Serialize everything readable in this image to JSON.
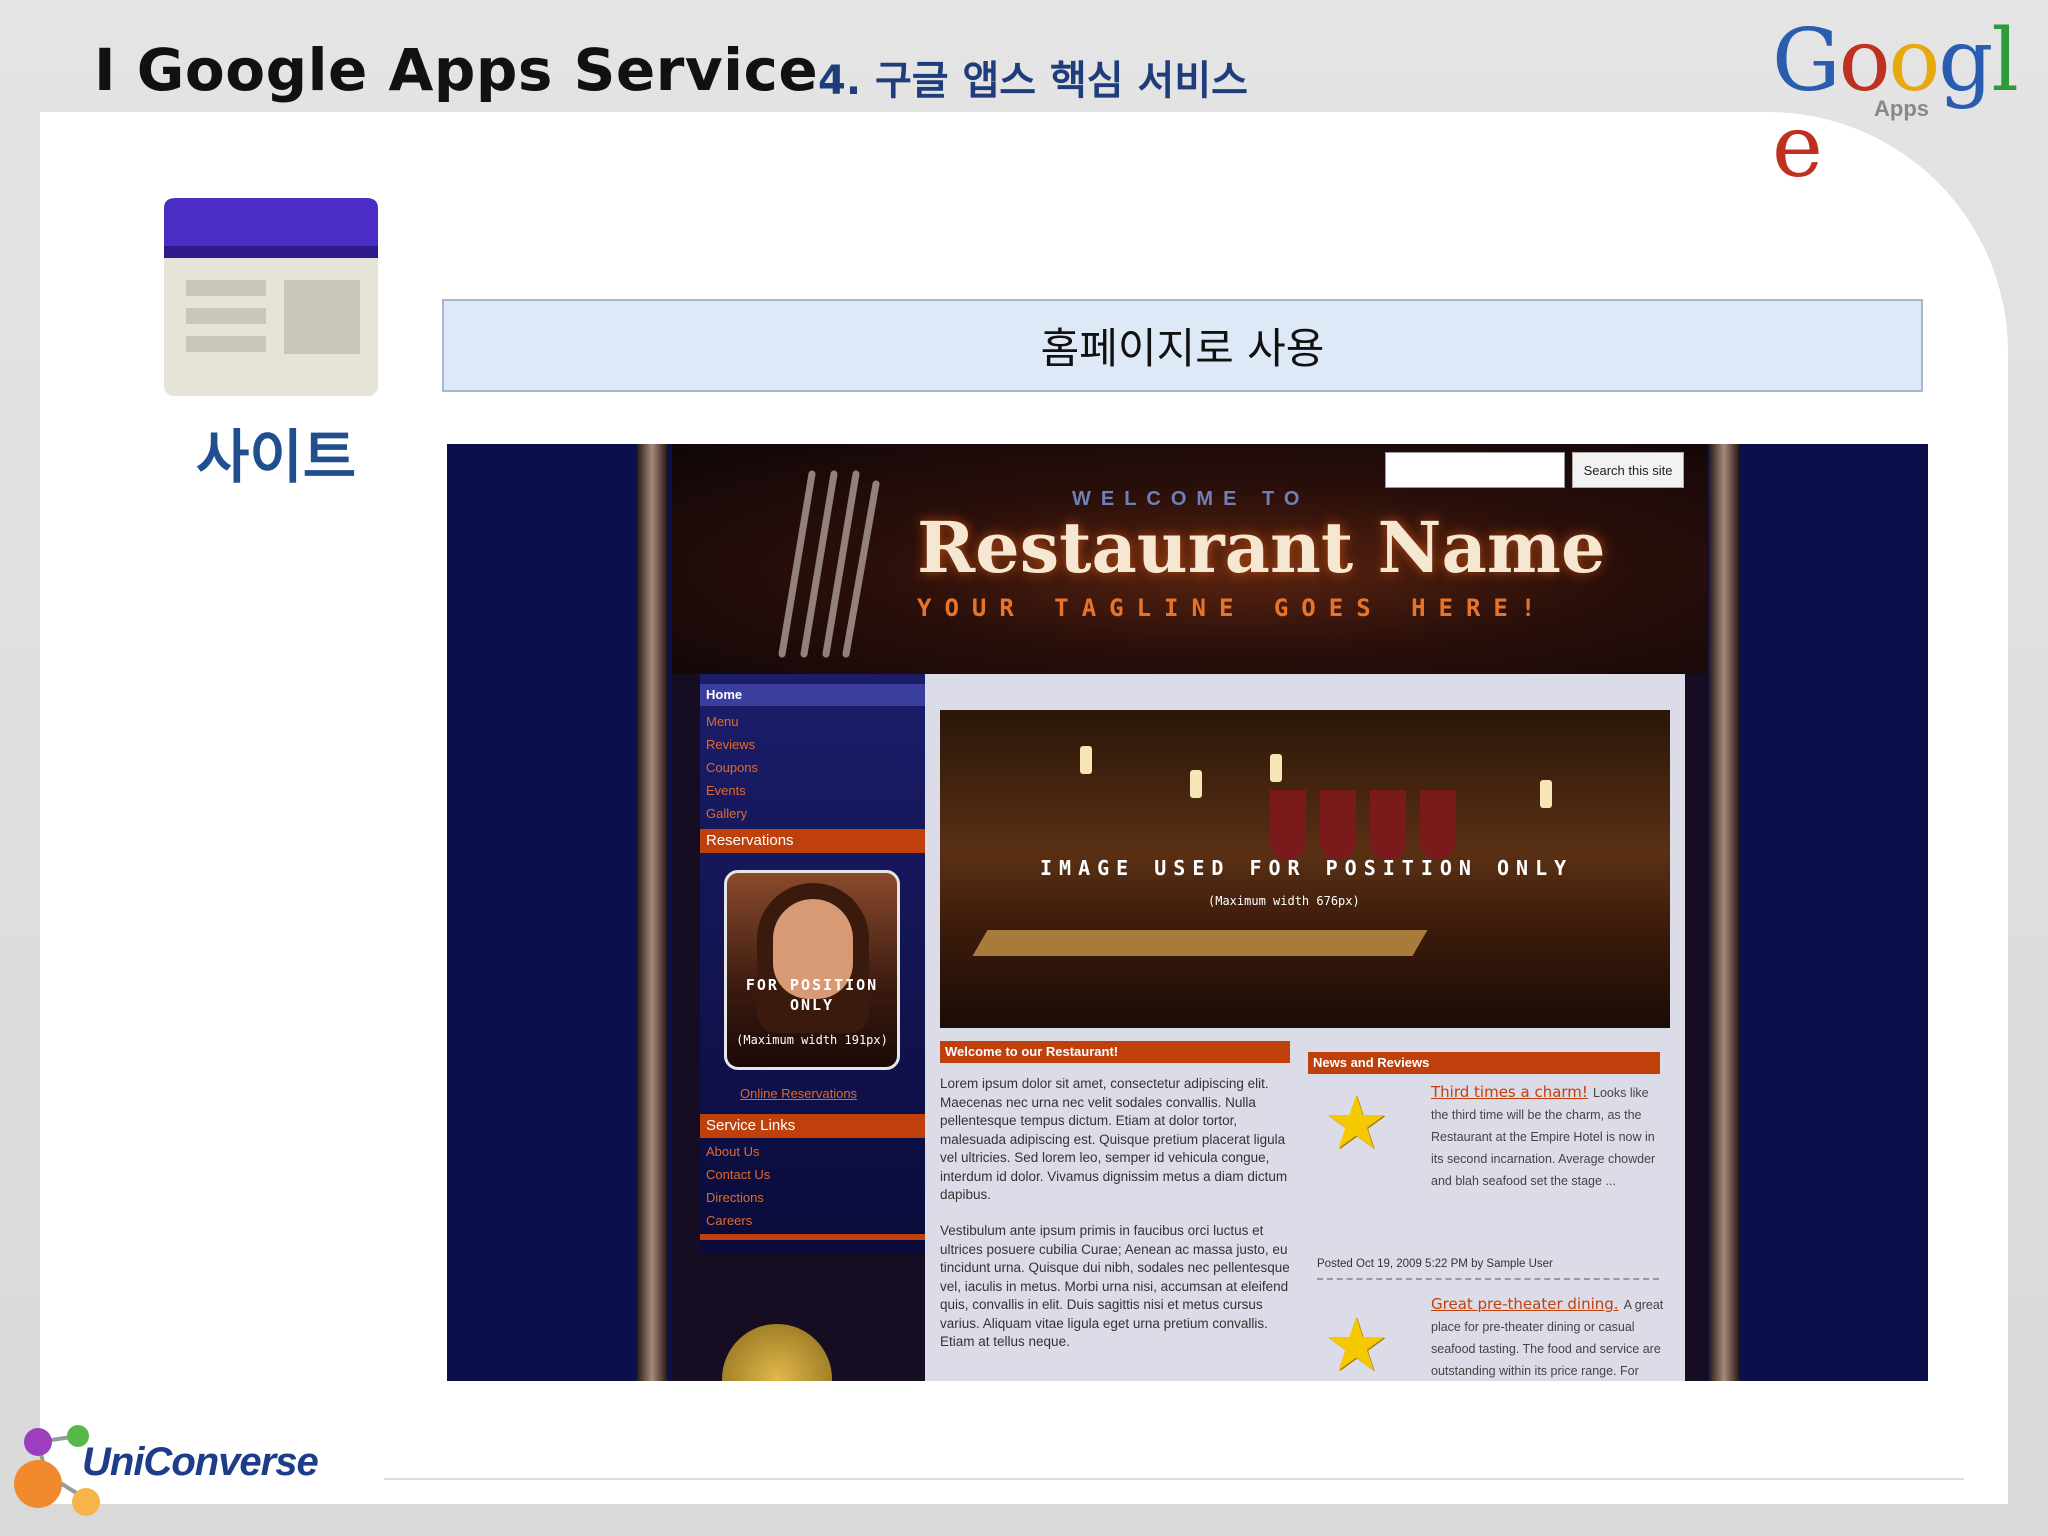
{
  "slide": {
    "title": "I  Google Apps Service",
    "subtitle": "4. 구글 앱스 핵심 서비스",
    "logo_google": "Google",
    "logo_apps": "Apps",
    "service_label": "사이트",
    "caption": "홈페이지로 사용",
    "footer_brand": "UniConverse"
  },
  "site": {
    "search_placeholder": "",
    "search_button": "Search this site",
    "welcome": "WELCOME TO",
    "name": "Restaurant Name",
    "tagline": "YOUR TAGLINE GOES HERE!",
    "nav": {
      "home": "Home",
      "items": [
        "Menu",
        "Reviews",
        "Coupons",
        "Events",
        "Gallery"
      ],
      "reservations": "Reservations",
      "portrait_fpo": "FOR POSITION ONLY",
      "portrait_fpo_small": "(Maximum width 191px)",
      "online_reservations": "Online Reservations",
      "service_links": "Service Links",
      "service_items": [
        "About Us",
        "Contact Us",
        "Directions",
        "Careers"
      ]
    },
    "hero": {
      "fpo": "IMAGE USED FOR POSITION ONLY",
      "fpo_small": "(Maximum width 676px)"
    },
    "welcome_section": {
      "heading": "Welcome to our Restaurant!",
      "para1": "Lorem ipsum dolor sit amet, consectetur adipiscing elit. Maecenas nec urna nec velit sodales convallis. Nulla pellentesque tempus dictum. Etiam at dolor tortor, malesuada adipiscing est. Quisque pretium placerat ligula vel ultricies. Sed lorem leo, semper id vehicula congue, interdum id dolor. Vivamus dignissim metus a diam dictum dapibus.",
      "para2": "Vestibulum ante ipsum primis in faucibus orci luctus et ultrices posuere cubilia Curae; Aenean ac massa justo, eu tincidunt urna. Quisque dui nibh, sodales nec pellentesque vel, iaculis in metus. Morbi urna nisi, accumsan at eleifend quis, convallis in elit. Duis sagittis nisi et metus cursus varius. Aliquam vitae ligula eget urna pretium convallis. Etiam at tellus neque."
    },
    "news": {
      "heading": "News and Reviews",
      "item1_title": "Third times a charm!",
      "item1_text": "Looks like the third time will be the charm, as the Restaurant at the Empire Hotel is now in its second incarnation. Average chowder and blah seafood set the stage ...",
      "posted": "Posted Oct 19, 2009 5:22 PM by Sample User",
      "item2_title": "Great pre-theater dining.",
      "item2_text": "A great place for pre-theater dining or casual seafood tasting. The food and service are outstanding within its price range. For starter, they have a variety of fresh oysters ..."
    }
  }
}
